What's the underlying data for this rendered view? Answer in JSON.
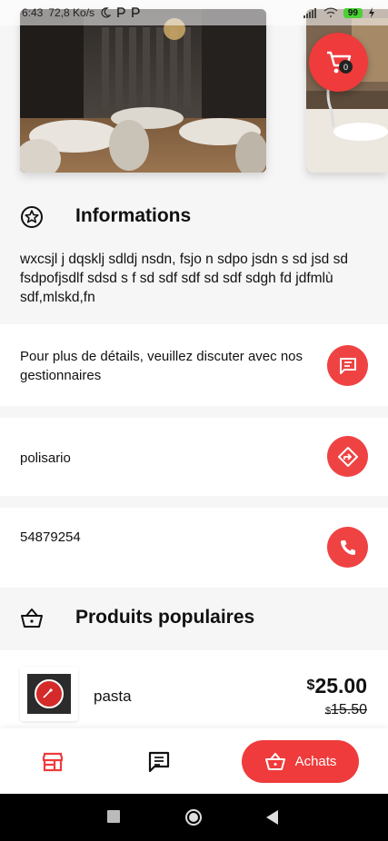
{
  "status": {
    "time": "6:43",
    "speed": "72,8 Ko/s",
    "battery": "99"
  },
  "cart": {
    "count": "0"
  },
  "info": {
    "title": "Informations",
    "description": "wxcsjl j dqsklj sdldj nsdn, fsjo n sdpo jsdn s sd jsd sd fsdpofjsdlf sdsd s f sd sdf sdf sd sdf sdgh fd jdfmlù sdf,mlskd,fn"
  },
  "contact": {
    "chat_text": "Pour plus de détails, veuillez discuter avec nos gestionnaires",
    "location_text": "polisario",
    "phone_text": "54879254"
  },
  "popular": {
    "title": "Produits populaires",
    "products": [
      {
        "name": "pasta",
        "currency": "$",
        "price": "25.00",
        "old_price": "15.50"
      }
    ]
  },
  "nav": {
    "achats_label": "Achats"
  },
  "colors": {
    "accent": "#ef3b3b"
  }
}
